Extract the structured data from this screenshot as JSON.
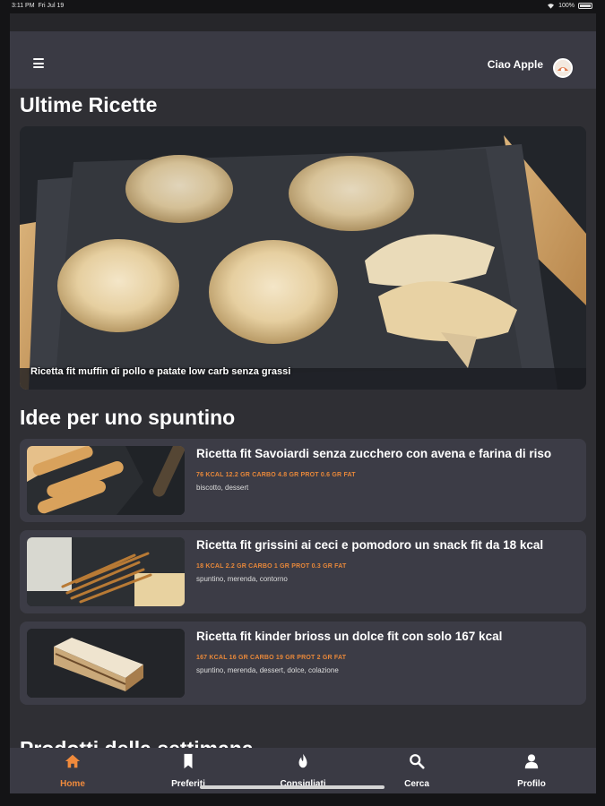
{
  "status_bar": {
    "time": "3:11 PM",
    "date": "Fri Jul 19",
    "battery": "100%"
  },
  "header": {
    "greeting": "Ciao Apple"
  },
  "sections": {
    "latest_title": "Ultime Ricette",
    "snack_title": "Idee per uno spuntino",
    "week_title": "Prodotti della settimana"
  },
  "hero": {
    "caption": "Ricetta fit muffin di pollo e patate low carb senza grassi"
  },
  "recipes": [
    {
      "title": "Ricetta fit Savoiardi senza zucchero con avena e farina di riso",
      "macros": "76 KCAL 12.2 GR CARBO 4.8 GR PROT 0.6 GR FAT",
      "tags": "biscotto, dessert"
    },
    {
      "title": "Ricetta fit grissini ai ceci e pomodoro un snack fit da 18 kcal",
      "macros": "18 KCAL 2.2 GR CARBO 1 GR PROT 0.3 GR FAT",
      "tags": "spuntino, merenda, contorno"
    },
    {
      "title": "Ricetta fit kinder brioss un dolce fit con solo 167 kcal",
      "macros": "167 KCAL 16 GR CARBO 19 GR PROT 2 GR FAT",
      "tags": "spuntino, merenda, dessert, dolce, colazione"
    }
  ],
  "nav": [
    {
      "label": "Home",
      "icon": "home-icon"
    },
    {
      "label": "Preferiti",
      "icon": "bookmark-icon"
    },
    {
      "label": "Consigliati",
      "icon": "flame-icon"
    },
    {
      "label": "Cerca",
      "icon": "search-icon"
    },
    {
      "label": "Profilo",
      "icon": "person-icon"
    }
  ],
  "colors": {
    "accent": "#f08a3c",
    "card": "#3c3c46",
    "background": "#2f2f34",
    "appbar": "#3a3a44"
  }
}
